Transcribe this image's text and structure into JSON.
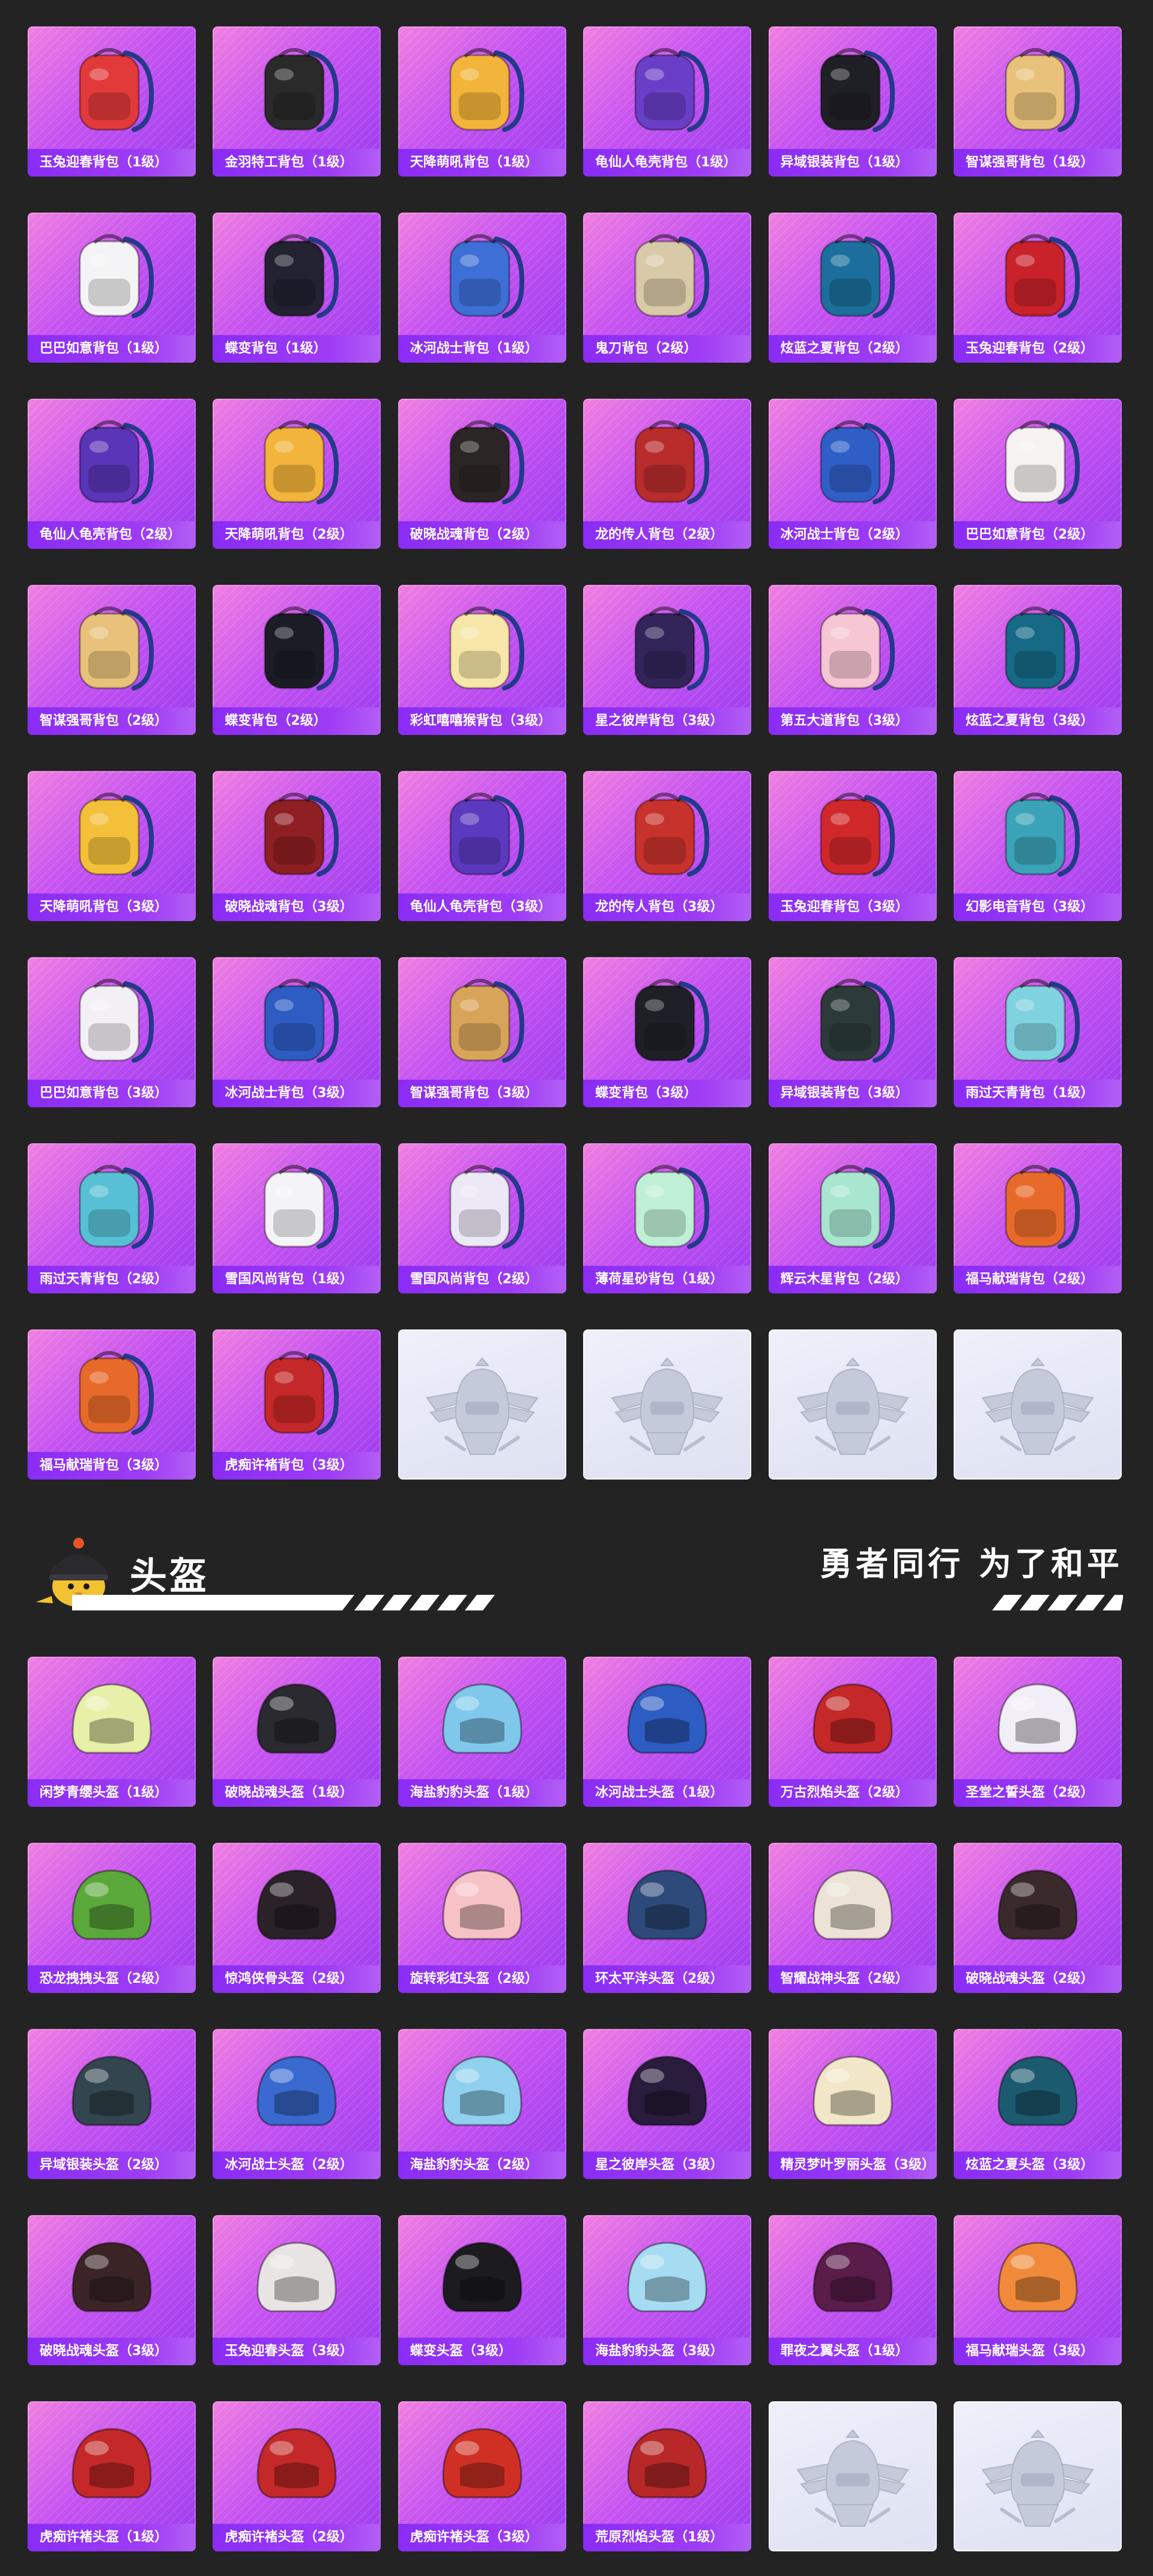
{
  "colors": {
    "page_background": "#232323",
    "card_gradient_start": "#f07fe0",
    "card_gradient_end": "#9b3cf0",
    "label_bar": "#8a2cf5",
    "placeholder_card": "#e4e7f5"
  },
  "backpacks": {
    "items": [
      {
        "label": "玉兔迎春背包（1级）",
        "icon": "backpack-icon",
        "color": "#e23a3a"
      },
      {
        "label": "金羽特工背包（1级）",
        "icon": "backpack-icon",
        "color": "#2a2a2a"
      },
      {
        "label": "天降萌吼背包（1级）",
        "icon": "backpack-icon",
        "color": "#f2b43a"
      },
      {
        "label": "龟仙人龟壳背包（1级）",
        "icon": "backpack-icon",
        "color": "#6a3fc8"
      },
      {
        "label": "异域银装背包（1级）",
        "icon": "backpack-icon",
        "color": "#1f1f26"
      },
      {
        "label": "智谋强哥背包（1级）",
        "icon": "backpack-icon",
        "color": "#e8c27a"
      },
      {
        "label": "巴巴如意背包（1级）",
        "icon": "backpack-icon",
        "color": "#f4f4f6"
      },
      {
        "label": "蝶变背包（1级）",
        "icon": "backpack-icon",
        "color": "#222230"
      },
      {
        "label": "冰河战士背包（1级）",
        "icon": "backpack-icon",
        "color": "#3d6fd6"
      },
      {
        "label": "鬼刀背包（2级）",
        "icon": "backpack-icon",
        "color": "#d8c9a8"
      },
      {
        "label": "炫蓝之夏背包（2级）",
        "icon": "backpack-icon",
        "color": "#1c6f9c"
      },
      {
        "label": "玉兔迎春背包（2级）",
        "icon": "backpack-icon",
        "color": "#c9222a"
      },
      {
        "label": "龟仙人龟壳背包（2级）",
        "icon": "backpack-icon",
        "color": "#5a35b8"
      },
      {
        "label": "天降萌吼背包（2级）",
        "icon": "backpack-icon",
        "color": "#f2b43a"
      },
      {
        "label": "破晓战魂背包（2级）",
        "icon": "backpack-icon",
        "color": "#2c2526"
      },
      {
        "label": "龙的传人背包（2级）",
        "icon": "backpack-icon",
        "color": "#b92c2c"
      },
      {
        "label": "冰河战士背包（2级）",
        "icon": "backpack-icon",
        "color": "#2f5fc6"
      },
      {
        "label": "巴巴如意背包（2级）",
        "icon": "backpack-icon",
        "color": "#f6f2f2"
      },
      {
        "label": "智谋强哥背包（2级）",
        "icon": "backpack-icon",
        "color": "#e8c27a"
      },
      {
        "label": "蝶变背包（2级）",
        "icon": "backpack-icon",
        "color": "#1c1c26"
      },
      {
        "label": "彩虹嘻嘻猴背包（3级）",
        "icon": "backpack-icon",
        "color": "#f6e6a8"
      },
      {
        "label": "星之彼岸背包（3级）",
        "icon": "backpack-icon",
        "color": "#33245a"
      },
      {
        "label": "第五大道背包（3级）",
        "icon": "backpack-icon",
        "color": "#f6c6d4"
      },
      {
        "label": "炫蓝之夏背包（3级）",
        "icon": "backpack-icon",
        "color": "#166a86"
      },
      {
        "label": "天降萌吼背包（3级）",
        "icon": "backpack-icon",
        "color": "#f4c03a"
      },
      {
        "label": "破晓战魂背包（3级）",
        "icon": "backpack-icon",
        "color": "#8e1f22"
      },
      {
        "label": "龟仙人龟壳背包（3级）",
        "icon": "backpack-icon",
        "color": "#5b3ac0"
      },
      {
        "label": "龙的传人背包（3级）",
        "icon": "backpack-icon",
        "color": "#c8322c"
      },
      {
        "label": "玉兔迎春背包（3级）",
        "icon": "backpack-icon",
        "color": "#d0282a"
      },
      {
        "label": "幻影电音背包（3级）",
        "icon": "backpack-icon",
        "color": "#3aa3b8"
      },
      {
        "label": "巴巴如意背包（3级）",
        "icon": "backpack-icon",
        "color": "#f2f0f4"
      },
      {
        "label": "冰河战士背包（3级）",
        "icon": "backpack-icon",
        "color": "#2d5cc2"
      },
      {
        "label": "智谋强哥背包（3级）",
        "icon": "backpack-icon",
        "color": "#d8a45a"
      },
      {
        "label": "蝶变背包（3级）",
        "icon": "backpack-icon",
        "color": "#1f1f28"
      },
      {
        "label": "异域银装背包（3级）",
        "icon": "backpack-icon",
        "color": "#2c3a3a"
      },
      {
        "label": "雨过天青背包（1级）",
        "icon": "backpack-icon",
        "color": "#7fd2e0"
      },
      {
        "label": "雨过天青背包（2级）",
        "icon": "backpack-icon",
        "color": "#57c0d4"
      },
      {
        "label": "雪国风尚背包（1级）",
        "icon": "backpack-icon",
        "color": "#f4f4f8"
      },
      {
        "label": "雪国风尚背包（2级）",
        "icon": "backpack-icon",
        "color": "#ece8f6"
      },
      {
        "label": "薄荷星砂背包（1级）",
        "icon": "backpack-icon",
        "color": "#bff0d6"
      },
      {
        "label": "辉云木星背包（2级）",
        "icon": "backpack-icon",
        "color": "#a8e6d0"
      },
      {
        "label": "福马献瑞背包（2级）",
        "icon": "backpack-icon",
        "color": "#e86a2a"
      },
      {
        "label": "福马献瑞背包（3级）",
        "icon": "backpack-icon",
        "color": "#e86a2a"
      },
      {
        "label": "虎痴许褚背包（3级）",
        "icon": "backpack-icon",
        "color": "#c42828"
      }
    ],
    "placeholders": 4
  },
  "helmet_header": {
    "title": "头盔",
    "slogan": "勇者同行 为了和平",
    "mascot_icon": "chick-helmet-mascot-icon"
  },
  "helmets": {
    "items": [
      {
        "label": "闲梦青缨头盔（1级）",
        "icon": "helmet-icon",
        "color": "#e6f0a8"
      },
      {
        "label": "破晓战魂头盔（1级）",
        "icon": "helmet-icon",
        "color": "#2a2a30"
      },
      {
        "label": "海盐豹豹头盔（1级）",
        "icon": "helmet-icon",
        "color": "#7fc8ec"
      },
      {
        "label": "冰河战士头盔（1级）",
        "icon": "helmet-icon",
        "color": "#2d5cc2"
      },
      {
        "label": "万古烈焰头盔（2级）",
        "icon": "helmet-icon",
        "color": "#c42828"
      },
      {
        "label": "圣堂之誓头盔（2级）",
        "icon": "helmet-icon",
        "color": "#f2eef8"
      },
      {
        "label": "恐龙拽拽头盔（2级）",
        "icon": "helmet-icon",
        "color": "#5aa83a"
      },
      {
        "label": "惊鸿侠骨头盔（2级）",
        "icon": "helmet-icon",
        "color": "#2a2228"
      },
      {
        "label": "旋转彩虹头盔（2级）",
        "icon": "helmet-icon",
        "color": "#f6c2c6"
      },
      {
        "label": "环太平洋头盔（2级）",
        "icon": "helmet-icon",
        "color": "#2d4a7a"
      },
      {
        "label": "智耀战神头盔（2级）",
        "icon": "helmet-icon",
        "color": "#ece2d6"
      },
      {
        "label": "破晓战魂头盔（2级）",
        "icon": "helmet-icon",
        "color": "#3a2a2c"
      },
      {
        "label": "异域银装头盔（2级）",
        "icon": "helmet-icon",
        "color": "#33454e"
      },
      {
        "label": "冰河战士头盔（2级）",
        "icon": "helmet-icon",
        "color": "#3a6ad0"
      },
      {
        "label": "海盐豹豹头盔（2级）",
        "icon": "helmet-icon",
        "color": "#8fd0ee"
      },
      {
        "label": "星之彼岸头盔（3级）",
        "icon": "helmet-icon",
        "color": "#2a1c3c"
      },
      {
        "label": "精灵梦叶罗丽头盔（3级）",
        "icon": "helmet-icon",
        "color": "#f2e6c8"
      },
      {
        "label": "炫蓝之夏头盔（3级）",
        "icon": "helmet-icon",
        "color": "#1c5a70"
      },
      {
        "label": "破晓战魂头盔（3级）",
        "icon": "helmet-icon",
        "color": "#3a2426"
      },
      {
        "label": "玉兔迎春头盔（3级）",
        "icon": "helmet-icon",
        "color": "#e8e4e4"
      },
      {
        "label": "蝶变头盔（3级）",
        "icon": "helmet-icon",
        "color": "#1c1c20"
      },
      {
        "label": "海盐豹豹头盔（3级）",
        "icon": "helmet-icon",
        "color": "#a6dcf2"
      },
      {
        "label": "罪夜之翼头盔（1级）",
        "icon": "helmet-icon",
        "color": "#5a1c4a"
      },
      {
        "label": "福马献瑞头盔（3级）",
        "icon": "helmet-icon",
        "color": "#f08a3a"
      },
      {
        "label": "虎痴许褚头盔（1级）",
        "icon": "helmet-icon",
        "color": "#c42828"
      },
      {
        "label": "虎痴许褚头盔（2级）",
        "icon": "helmet-icon",
        "color": "#c42828"
      },
      {
        "label": "虎痴许褚头盔（3级）",
        "icon": "helmet-icon",
        "color": "#d03024"
      },
      {
        "label": "荒原烈焰头盔（1级）",
        "icon": "helmet-icon",
        "color": "#b82828"
      }
    ],
    "placeholders": 2
  },
  "placeholder_icon": "winged-helmet-emblem-icon"
}
